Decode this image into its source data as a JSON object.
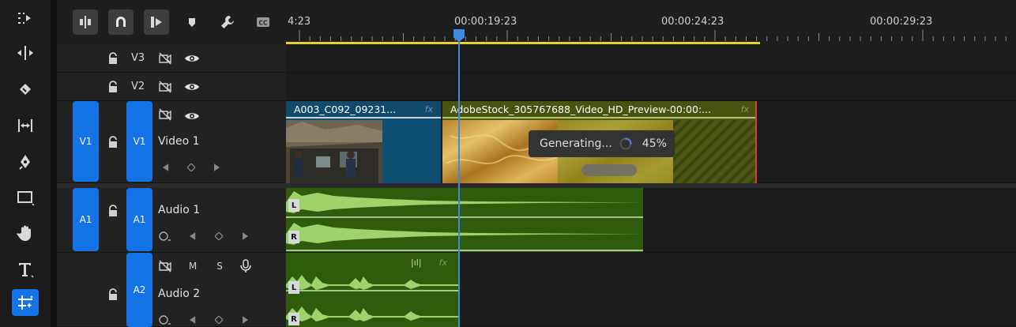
{
  "tools": [
    "track-select-forward",
    "ripple-edit",
    "razor",
    "slip",
    "pen",
    "rectangle",
    "hand",
    "type",
    "generative-extend"
  ],
  "header_buttons": [
    "insert-overwrite-toggle",
    "snap",
    "linked-selection",
    "add-marker",
    "settings",
    "captions"
  ],
  "ruler": {
    "timecodes": [
      {
        "label": "4:23",
        "pos": 0
      },
      {
        "label": "00:00:19:23",
        "pos": 1
      },
      {
        "label": "00:00:24:23",
        "pos": 2
      },
      {
        "label": "00:00:29:23",
        "pos": 3
      }
    ]
  },
  "tracks": {
    "v3": {
      "label": "V3"
    },
    "v2": {
      "label": "V2"
    },
    "v1": {
      "target": "V1",
      "label": "V1",
      "name": "Video 1"
    },
    "a1": {
      "target": "A1",
      "label": "A1",
      "name": "Audio 1"
    },
    "a2": {
      "label": "A2",
      "name": "Audio 2",
      "m": "M",
      "s": "S"
    }
  },
  "clips": {
    "clip1": {
      "title": "A003_C092_09231...",
      "fx": "fx"
    },
    "clip2": {
      "title": "AdobeStock_305767688_Video_HD_Preview-00:00:...",
      "fx": "fx"
    },
    "a2clip_fx": "fx"
  },
  "channels": {
    "left": "L",
    "right": "R"
  },
  "generating": {
    "text": "Generating...",
    "percent": "45%",
    "progress": 0.45
  },
  "colors": {
    "accent": "#1473e6",
    "playhead": "#3f8ae0",
    "audio": "#2f5c0c",
    "wave": "#9ed36b",
    "workarea": "#e8d22a"
  }
}
